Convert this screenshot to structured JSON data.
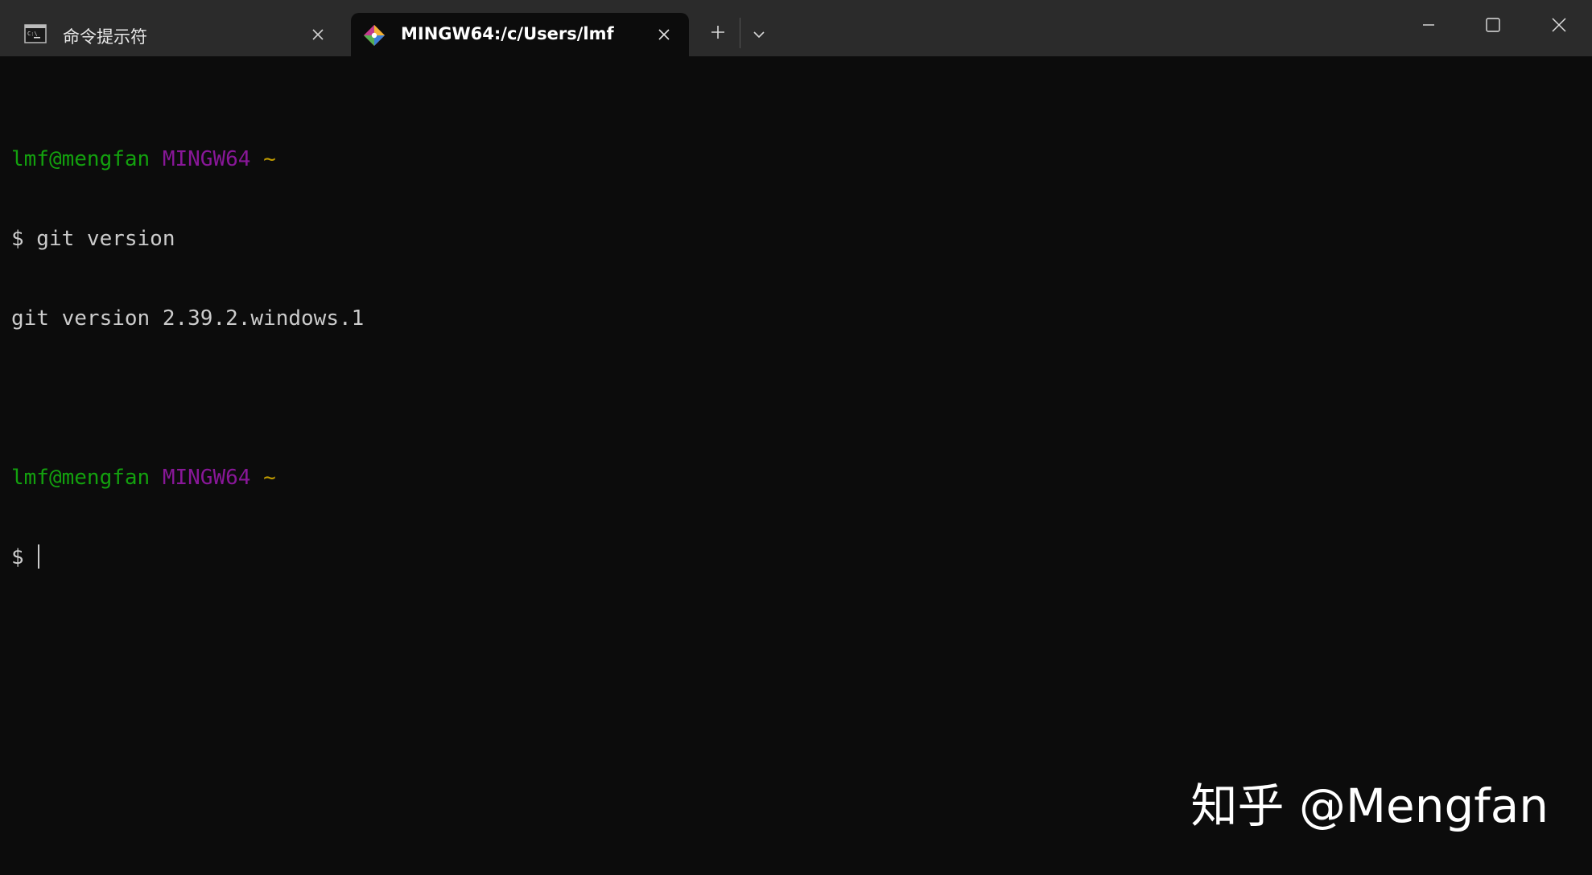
{
  "tabs": [
    {
      "label": "命令提示符",
      "icon": "cmd-icon",
      "active": false
    },
    {
      "label": "MINGW64:/c/Users/lmf",
      "icon": "git-icon",
      "active": true
    }
  ],
  "controls": {
    "new_tab_icon": "plus-icon",
    "dropdown_icon": "chevron-down-icon",
    "minimize_icon": "minimize-icon",
    "maximize_icon": "maximize-icon",
    "close_icon": "close-icon"
  },
  "terminal": {
    "prompt1": {
      "user": "lmf@mengfan",
      "host": "MINGW64",
      "path": "~"
    },
    "command": "$ git version",
    "output": "git version 2.39.2.windows.1",
    "prompt2": {
      "user": "lmf@mengfan",
      "host": "MINGW64",
      "path": "~"
    },
    "input_prompt": "$ "
  },
  "watermark": "知乎 @Mengfan",
  "colors": {
    "background": "#0c0c0c",
    "titlebar": "#2b2b2b",
    "user": "#13a10e",
    "host": "#881798",
    "path": "#c19c00",
    "text": "#cccccc"
  }
}
